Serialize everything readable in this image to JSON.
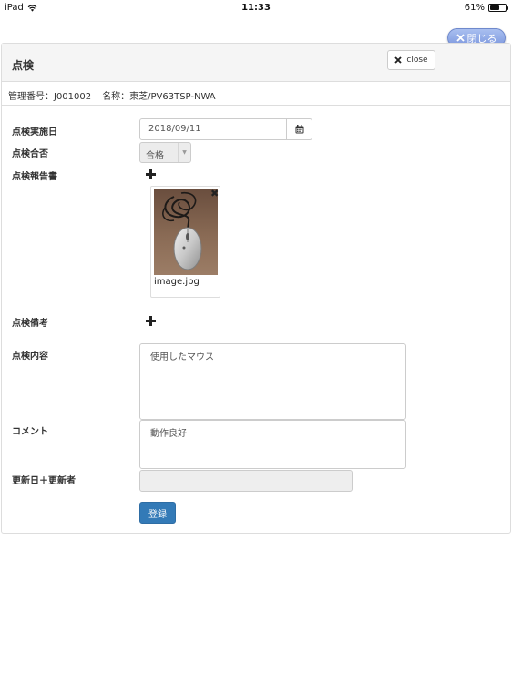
{
  "status_bar": {
    "device": "iPad",
    "time": "11:33",
    "battery": "61%",
    "battery_level": 0.61
  },
  "close_pill": {
    "label": "閉じる"
  },
  "panel": {
    "title": "点検",
    "close_button_label": "close",
    "info": {
      "management_number": "管理番号：J001002",
      "name": "名称：東芝/PV63TSP-NWA"
    }
  },
  "form": {
    "inspection_date": {
      "label": "点検実施日",
      "value": "2018/09/11"
    },
    "pass_fail": {
      "label": "点検合否",
      "selected": "合格"
    },
    "report": {
      "label": "点検報告書",
      "attachment_name": "image.jpg"
    },
    "remarks": {
      "label": "点検備考"
    },
    "content": {
      "label": "点検内容",
      "value": "使用したマウス"
    },
    "comment": {
      "label": "コメント",
      "value": "動作良好"
    },
    "updated": {
      "label": "更新日＋更新者",
      "value": ""
    },
    "submit_label": "登録"
  },
  "icons": {
    "wifi": "wifi-icon",
    "battery": "battery-icon",
    "close": "close-icon",
    "calendar": "calendar-icon",
    "dropdown": "chevron-down-icon",
    "add": "plus-icon",
    "delete": "delete-icon"
  },
  "colors": {
    "primary": "#337ab7",
    "pill": "#8aa4e3",
    "panel_heading": "#f5f5f5"
  }
}
